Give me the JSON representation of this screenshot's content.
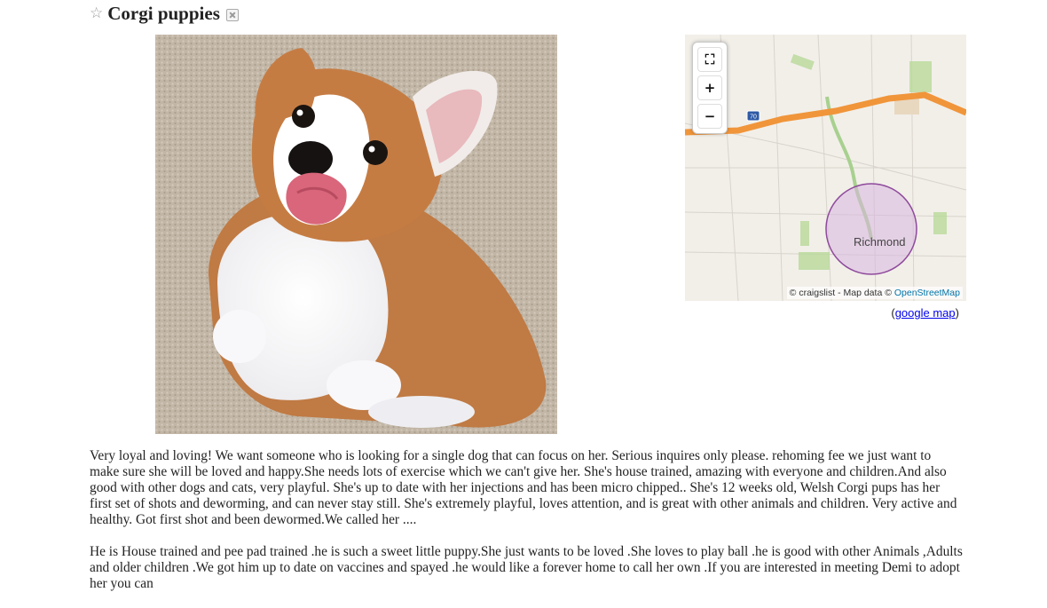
{
  "posting": {
    "star_icon": "☆",
    "title": "Corgi puppies"
  },
  "image": {
    "alt": "Corgi puppy lying on carpet",
    "icon": "corgi-puppy-photo"
  },
  "map": {
    "controls": {
      "fullscreen": "⛶",
      "zoom_in": "+",
      "zoom_out": "−"
    },
    "highway_label": "70",
    "city_label": "Richmond",
    "attribution_prefix": "© craigslist - Map data © ",
    "attribution_link": "OpenStreetMap",
    "google_map_prefix": "(",
    "google_map_link": "google map",
    "google_map_suffix": ")",
    "colors": {
      "highway": "#f0953a",
      "circle_fill": "#d9b7e0",
      "circle_stroke": "#8e4a9c",
      "park": "#b9d99a"
    }
  },
  "description": {
    "paragraph1": "Very loyal and loving! We want someone who is looking for a single dog that can focus on her. Serious inquires only please. rehoming fee we just want to make sure she will be loved and happy.She needs lots of exercise which we can't give her. She's house trained, amazing with everyone and children.And also good with other dogs and cats, very playful. She's up to date with her injections and has been micro chipped.. She's 12 weeks old, Welsh Corgi pups has her first set of shots and deworming, and can never stay still. She's extremely playful, loves attention, and is great with other animals and children. Very active and healthy. Got first shot and been dewormed.We called her ....",
    "paragraph2": "He is House trained and pee pad trained .he is such a sweet little puppy.She just wants to be loved .She loves to play ball .he is good with other Animals ,Adults and older children .We got him up to date on vaccines and spayed .he would like a forever home to call her own .If you are interested in meeting Demi to adopt her you can"
  }
}
